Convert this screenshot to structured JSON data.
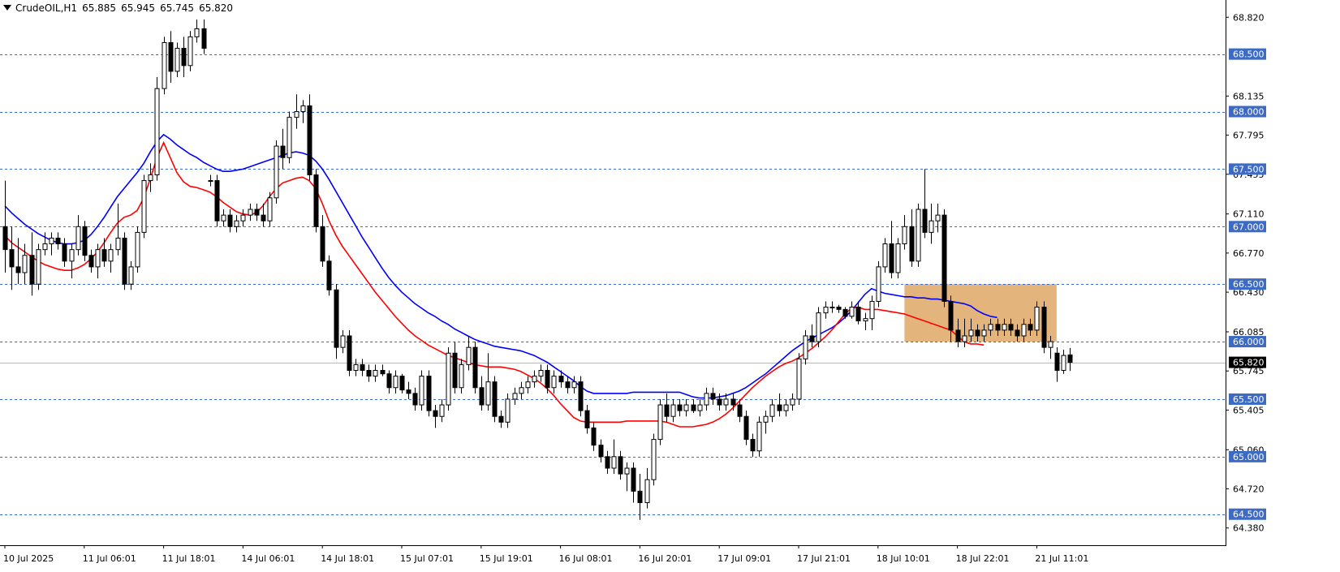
{
  "header": {
    "symbol": "CrudeOIL,H1",
    "open": "65.885",
    "high": "65.945",
    "low": "65.745",
    "close": "65.820"
  },
  "colors": {
    "up_body": "#ffffff",
    "down_body": "#000000",
    "wick": "#000000",
    "ma_fast": "#ff0000",
    "ma_slow": "#0000ff",
    "level_line": "#3d6bc4",
    "level_tag_bg": "#3d6bc4",
    "level_tag_text": "#ffffff",
    "current_line": "#b8b8b8",
    "current_tag_bg": "#000000",
    "current_tag_text": "#ffffff",
    "zone_fill": "#dea866",
    "axis": "#000000"
  },
  "chart_data": {
    "type": "candlestick",
    "symbol": "CrudeOIL",
    "timeframe": "H1",
    "y_range": [
      64.23,
      68.97
    ],
    "y_ticks": [
      "68.820",
      "68.135",
      "67.795",
      "67.455",
      "67.110",
      "66.770",
      "66.430",
      "66.085",
      "65.745",
      "65.405",
      "65.060",
      "64.720",
      "64.380"
    ],
    "x_labels": [
      "10 Jul 2025",
      "11 Jul 06:01",
      "11 Jul 18:01",
      "14 Jul 06:01",
      "14 Jul 18:01",
      "15 Jul 07:01",
      "15 Jul 19:01",
      "16 Jul 08:01",
      "16 Jul 20:01",
      "17 Jul 09:01",
      "17 Jul 21:01",
      "18 Jul 10:01",
      "18 Jul 22:01",
      "21 Jul 11:01"
    ],
    "x_label_index": [
      0,
      12,
      24,
      36,
      48,
      60,
      72,
      84,
      96,
      108,
      120,
      132,
      144,
      156
    ],
    "levels": [
      "68.500",
      "68.000",
      "67.500",
      "67.000",
      "66.500",
      "66.000",
      "65.500",
      "65.000",
      "64.500"
    ],
    "current_price": "65.820",
    "zone": {
      "start_index": 136,
      "end_index": 159,
      "top": 66.5,
      "bottom": 66.0
    },
    "candles": [
      [
        67.0,
        67.4,
        66.6,
        66.8
      ],
      [
        66.8,
        67.0,
        66.45,
        66.65
      ],
      [
        66.65,
        66.9,
        66.5,
        66.6
      ],
      [
        66.6,
        66.85,
        66.5,
        66.75
      ],
      [
        66.75,
        66.95,
        66.4,
        66.5
      ],
      [
        66.5,
        66.85,
        66.45,
        66.8
      ],
      [
        66.8,
        66.95,
        66.75,
        66.85
      ],
      [
        66.85,
        66.95,
        66.75,
        66.9
      ],
      [
        66.9,
        66.95,
        66.8,
        66.85
      ],
      [
        66.85,
        66.9,
        66.65,
        66.7
      ],
      [
        66.7,
        66.85,
        66.55,
        66.8
      ],
      [
        66.8,
        67.1,
        66.75,
        67.0
      ],
      [
        67.0,
        67.05,
        66.7,
        66.75
      ],
      [
        66.75,
        66.8,
        66.6,
        66.65
      ],
      [
        66.65,
        66.85,
        66.55,
        66.8
      ],
      [
        66.8,
        66.9,
        66.65,
        66.7
      ],
      [
        66.7,
        66.85,
        66.6,
        66.8
      ],
      [
        66.8,
        67.2,
        66.75,
        66.9
      ],
      [
        66.9,
        66.95,
        66.45,
        66.5
      ],
      [
        66.5,
        66.7,
        66.45,
        66.65
      ],
      [
        66.65,
        67.0,
        66.6,
        66.95
      ],
      [
        66.95,
        67.45,
        66.9,
        67.4
      ],
      [
        67.4,
        67.55,
        67.3,
        67.45
      ],
      [
        67.45,
        68.3,
        67.4,
        68.2
      ],
      [
        68.2,
        68.65,
        68.15,
        68.6
      ],
      [
        68.6,
        68.7,
        68.25,
        68.35
      ],
      [
        68.35,
        68.6,
        68.3,
        68.55
      ],
      [
        68.55,
        68.65,
        68.3,
        68.4
      ],
      [
        68.4,
        68.7,
        68.35,
        68.65
      ],
      [
        68.65,
        68.8,
        68.6,
        68.72
      ],
      [
        68.72,
        68.8,
        68.5,
        68.55
      ],
      [
        67.4,
        67.45,
        67.35,
        67.4
      ],
      [
        67.4,
        67.45,
        67.0,
        67.05
      ],
      [
        67.05,
        67.15,
        67.0,
        67.1
      ],
      [
        67.1,
        67.15,
        66.95,
        67.0
      ],
      [
        67.0,
        67.1,
        66.95,
        67.05
      ],
      [
        67.05,
        67.15,
        67.0,
        67.1
      ],
      [
        67.1,
        67.2,
        67.05,
        67.15
      ],
      [
        67.15,
        67.2,
        67.05,
        67.1
      ],
      [
        67.1,
        67.2,
        67.0,
        67.05
      ],
      [
        67.05,
        67.3,
        67.0,
        67.25
      ],
      [
        67.25,
        67.75,
        67.2,
        67.7
      ],
      [
        67.7,
        67.85,
        67.5,
        67.6
      ],
      [
        67.6,
        68.0,
        67.55,
        67.95
      ],
      [
        67.95,
        68.15,
        67.85,
        68.0
      ],
      [
        68.0,
        68.1,
        67.9,
        68.05
      ],
      [
        68.05,
        68.15,
        67.4,
        67.45
      ],
      [
        67.45,
        67.5,
        66.95,
        67.0
      ],
      [
        67.0,
        67.1,
        66.65,
        66.7
      ],
      [
        66.7,
        66.75,
        66.4,
        66.45
      ],
      [
        66.45,
        66.5,
        65.85,
        65.95
      ],
      [
        65.95,
        66.1,
        65.9,
        66.05
      ],
      [
        66.05,
        66.1,
        65.7,
        65.75
      ],
      [
        65.75,
        65.85,
        65.7,
        65.8
      ],
      [
        65.8,
        65.85,
        65.7,
        65.75
      ],
      [
        65.75,
        65.8,
        65.65,
        65.7
      ],
      [
        65.7,
        65.8,
        65.65,
        65.75
      ],
      [
        65.75,
        65.8,
        65.7,
        65.72
      ],
      [
        65.72,
        65.75,
        65.55,
        65.6
      ],
      [
        65.6,
        65.75,
        65.55,
        65.7
      ],
      [
        65.7,
        65.72,
        65.55,
        65.58
      ],
      [
        65.58,
        65.65,
        65.5,
        65.55
      ],
      [
        65.55,
        65.6,
        65.4,
        65.45
      ],
      [
        65.45,
        65.75,
        65.4,
        65.7
      ],
      [
        65.7,
        65.75,
        65.35,
        65.4
      ],
      [
        65.4,
        65.45,
        65.25,
        65.35
      ],
      [
        65.35,
        65.5,
        65.3,
        65.45
      ],
      [
        65.45,
        65.95,
        65.4,
        65.9
      ],
      [
        65.9,
        66.0,
        65.55,
        65.6
      ],
      [
        65.6,
        65.85,
        65.55,
        65.8
      ],
      [
        65.8,
        66.05,
        65.75,
        65.95
      ],
      [
        65.95,
        66.0,
        65.55,
        65.6
      ],
      [
        65.6,
        65.7,
        65.4,
        65.45
      ],
      [
        65.45,
        65.9,
        65.4,
        65.65
      ],
      [
        65.65,
        65.7,
        65.3,
        65.35
      ],
      [
        65.35,
        65.4,
        65.25,
        65.3
      ],
      [
        65.3,
        65.55,
        65.25,
        65.5
      ],
      [
        65.5,
        65.6,
        65.45,
        65.55
      ],
      [
        65.55,
        65.65,
        65.5,
        65.6
      ],
      [
        65.6,
        65.7,
        65.55,
        65.65
      ],
      [
        65.65,
        65.75,
        65.6,
        65.7
      ],
      [
        65.7,
        65.8,
        65.65,
        65.75
      ],
      [
        65.75,
        65.8,
        65.55,
        65.6
      ],
      [
        65.6,
        65.75,
        65.55,
        65.7
      ],
      [
        65.7,
        65.75,
        65.6,
        65.65
      ],
      [
        65.65,
        65.7,
        65.55,
        65.6
      ],
      [
        65.6,
        65.7,
        65.55,
        65.65
      ],
      [
        65.65,
        65.7,
        65.35,
        65.4
      ],
      [
        65.4,
        65.45,
        65.2,
        65.25
      ],
      [
        65.25,
        65.3,
        65.05,
        65.1
      ],
      [
        65.1,
        65.15,
        64.95,
        65.0
      ],
      [
        65.0,
        65.05,
        64.85,
        64.9
      ],
      [
        64.9,
        65.15,
        64.85,
        65.0
      ],
      [
        65.0,
        65.05,
        64.8,
        64.85
      ],
      [
        64.85,
        64.95,
        64.7,
        64.9
      ],
      [
        64.9,
        64.95,
        64.6,
        64.7
      ],
      [
        64.7,
        64.85,
        64.45,
        64.6
      ],
      [
        64.6,
        64.9,
        64.55,
        64.8
      ],
      [
        64.8,
        65.2,
        64.75,
        65.15
      ],
      [
        65.15,
        65.5,
        65.1,
        65.45
      ],
      [
        65.45,
        65.55,
        65.3,
        65.35
      ],
      [
        65.35,
        65.5,
        65.3,
        65.45
      ],
      [
        65.45,
        65.5,
        65.35,
        65.4
      ],
      [
        65.4,
        65.5,
        65.35,
        65.45
      ],
      [
        65.45,
        65.5,
        65.38,
        65.4
      ],
      [
        65.4,
        65.5,
        65.35,
        65.45
      ],
      [
        65.45,
        65.6,
        65.4,
        65.55
      ],
      [
        65.55,
        65.6,
        65.45,
        65.5
      ],
      [
        65.5,
        65.55,
        65.4,
        65.45
      ],
      [
        65.45,
        65.55,
        65.4,
        65.5
      ],
      [
        65.5,
        65.55,
        65.4,
        65.45
      ],
      [
        65.45,
        65.5,
        65.3,
        65.35
      ],
      [
        65.35,
        65.4,
        65.1,
        65.15
      ],
      [
        65.15,
        65.2,
        65.0,
        65.05
      ],
      [
        65.05,
        65.35,
        65.0,
        65.3
      ],
      [
        65.3,
        65.4,
        65.2,
        65.35
      ],
      [
        65.35,
        65.5,
        65.3,
        65.45
      ],
      [
        65.45,
        65.55,
        65.35,
        65.4
      ],
      [
        65.4,
        65.5,
        65.35,
        65.45
      ],
      [
        65.45,
        65.55,
        65.4,
        65.5
      ],
      [
        65.5,
        65.9,
        65.45,
        65.85
      ],
      [
        65.85,
        66.1,
        65.8,
        66.05
      ],
      [
        66.05,
        66.15,
        65.95,
        66.0
      ],
      [
        66.0,
        66.3,
        65.95,
        66.25
      ],
      [
        66.25,
        66.35,
        66.2,
        66.3
      ],
      [
        66.3,
        66.35,
        66.25,
        66.3
      ],
      [
        66.3,
        66.32,
        66.25,
        66.28
      ],
      [
        66.28,
        66.3,
        66.2,
        66.22
      ],
      [
        66.22,
        66.35,
        66.2,
        66.3
      ],
      [
        66.3,
        66.35,
        66.15,
        66.18
      ],
      [
        66.18,
        66.25,
        66.1,
        66.2
      ],
      [
        66.2,
        66.4,
        66.1,
        66.35
      ],
      [
        66.35,
        66.7,
        66.3,
        66.65
      ],
      [
        66.65,
        66.9,
        66.6,
        66.85
      ],
      [
        66.85,
        67.05,
        66.55,
        66.6
      ],
      [
        66.6,
        66.9,
        66.55,
        66.85
      ],
      [
        66.85,
        67.1,
        66.8,
        67.0
      ],
      [
        67.0,
        67.15,
        66.65,
        66.7
      ],
      [
        66.7,
        67.2,
        66.65,
        67.15
      ],
      [
        67.15,
        67.5,
        66.9,
        66.95
      ],
      [
        66.95,
        67.2,
        66.85,
        67.05
      ],
      [
        67.05,
        67.2,
        66.95,
        67.1
      ],
      [
        67.1,
        67.15,
        66.3,
        66.35
      ],
      [
        66.35,
        66.4,
        66.0,
        66.1
      ],
      [
        66.1,
        66.2,
        65.95,
        66.0
      ],
      [
        66.0,
        66.2,
        65.95,
        66.05
      ],
      [
        66.05,
        66.2,
        66.0,
        66.1
      ],
      [
        66.1,
        66.15,
        66.0,
        66.05
      ],
      [
        66.05,
        66.15,
        66.0,
        66.1
      ],
      [
        66.1,
        66.2,
        66.05,
        66.15
      ],
      [
        66.15,
        66.2,
        66.05,
        66.1
      ],
      [
        66.1,
        66.2,
        66.05,
        66.15
      ],
      [
        66.15,
        66.2,
        66.05,
        66.1
      ],
      [
        66.1,
        66.15,
        66.0,
        66.05
      ],
      [
        66.05,
        66.2,
        66.0,
        66.15
      ],
      [
        66.15,
        66.2,
        66.05,
        66.1
      ],
      [
        66.1,
        66.35,
        66.05,
        66.3
      ],
      [
        66.3,
        66.35,
        65.9,
        65.95
      ],
      [
        65.95,
        66.05,
        65.85,
        66.0
      ],
      [
        65.9,
        65.95,
        65.65,
        65.75
      ],
      [
        65.75,
        65.93,
        65.72,
        65.88
      ],
      [
        65.885,
        65.945,
        65.745,
        65.82
      ]
    ],
    "ma_fast": [
      66.92,
      66.86,
      66.82,
      66.78,
      66.74,
      66.7,
      66.67,
      66.65,
      66.63,
      66.62,
      66.62,
      66.64,
      66.67,
      66.72,
      66.78,
      66.86,
      66.95,
      67.03,
      67.08,
      67.1,
      67.14,
      67.25,
      67.42,
      67.6,
      67.73,
      67.6,
      67.47,
      67.39,
      67.35,
      67.34,
      67.32,
      67.3,
      67.26,
      67.21,
      67.17,
      67.13,
      67.11,
      67.1,
      67.12,
      67.18,
      67.26,
      67.33,
      67.38,
      67.4,
      67.42,
      67.43,
      67.4,
      67.33,
      67.2,
      67.05,
      66.93,
      66.83,
      66.75,
      66.67,
      66.59,
      66.51,
      66.43,
      66.36,
      66.29,
      66.22,
      66.16,
      66.1,
      66.05,
      66.01,
      65.97,
      65.94,
      65.91,
      65.88,
      65.86,
      65.84,
      65.82,
      65.8,
      65.79,
      65.78,
      65.78,
      65.78,
      65.77,
      65.76,
      65.74,
      65.71,
      65.68,
      65.64,
      65.59,
      65.53,
      65.46,
      65.4,
      65.34,
      65.31,
      65.3,
      65.3,
      65.3,
      65.3,
      65.3,
      65.3,
      65.31,
      65.31,
      65.31,
      65.31,
      65.31,
      65.31,
      65.3,
      65.28,
      65.26,
      65.26,
      65.26,
      65.27,
      65.28,
      65.3,
      65.33,
      65.37,
      65.42,
      65.48,
      65.54,
      65.6,
      65.65,
      65.7,
      65.74,
      65.78,
      65.81,
      65.83,
      65.86,
      65.9,
      65.94,
      65.99,
      66.04,
      66.1,
      66.17,
      66.24,
      66.29,
      66.3,
      66.28,
      66.28,
      66.28,
      66.27,
      66.26,
      66.25,
      66.24,
      66.22,
      66.2,
      66.18,
      66.16,
      66.14,
      66.12,
      66.1,
      66.05,
      66.0,
      65.98,
      65.98,
      65.97
    ],
    "ma_slow": [
      67.18,
      67.12,
      67.07,
      67.02,
      66.98,
      66.94,
      66.91,
      66.88,
      66.86,
      66.85,
      66.85,
      66.86,
      66.88,
      66.93,
      67.0,
      67.08,
      67.17,
      67.26,
      67.33,
      67.4,
      67.47,
      67.55,
      67.65,
      67.74,
      67.8,
      67.76,
      67.71,
      67.67,
      67.63,
      67.6,
      67.56,
      67.53,
      67.5,
      67.48,
      67.48,
      67.49,
      67.5,
      67.52,
      67.54,
      67.56,
      67.58,
      67.6,
      67.62,
      67.64,
      67.65,
      67.64,
      67.62,
      67.57,
      67.5,
      67.41,
      67.31,
      67.21,
      67.11,
      67.01,
      66.91,
      66.82,
      66.73,
      66.64,
      66.56,
      66.49,
      66.43,
      66.38,
      66.33,
      66.29,
      66.25,
      66.22,
      66.18,
      66.15,
      66.11,
      66.08,
      66.05,
      66.02,
      66.0,
      65.98,
      65.96,
      65.95,
      65.94,
      65.93,
      65.92,
      65.9,
      65.88,
      65.85,
      65.82,
      65.78,
      65.74,
      65.7,
      65.66,
      65.61,
      65.57,
      65.55,
      65.55,
      65.55,
      65.55,
      65.55,
      65.55,
      65.56,
      65.56,
      65.56,
      65.56,
      65.56,
      65.56,
      65.56,
      65.56,
      65.54,
      65.52,
      65.51,
      65.51,
      65.51,
      65.52,
      65.53,
      65.55,
      65.57,
      65.6,
      65.64,
      65.68,
      65.72,
      65.77,
      65.82,
      65.87,
      65.92,
      65.96,
      66.0,
      66.03,
      66.06,
      66.09,
      66.12,
      66.16,
      66.21,
      66.27,
      66.34,
      66.41,
      66.46,
      66.44,
      66.42,
      66.41,
      66.4,
      66.39,
      66.39,
      66.38,
      66.38,
      66.37,
      66.37,
      66.36,
      66.35,
      66.34,
      66.33,
      66.31,
      66.27,
      66.24,
      66.22,
      66.21
    ]
  }
}
